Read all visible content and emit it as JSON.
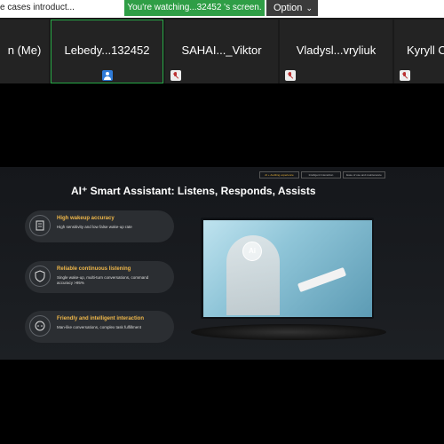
{
  "topbar": {
    "title_fragment": "e cases introduct...",
    "watching_text": "You're watching...32452 's screen.",
    "option_label": "Option"
  },
  "participants": [
    {
      "name": "n (Me)"
    },
    {
      "name": "Lebedy...132452"
    },
    {
      "name": "SAHAI..._Viktor"
    },
    {
      "name": "Vladysl...vryliuk"
    },
    {
      "name": "Kyryll O"
    }
  ],
  "slide": {
    "tabs": [
      "AI + Auditing experience",
      "Intelligent Interaction",
      "Ease of use and maintenance"
    ],
    "title": "AI⁺ Smart Assistant: Listens, Responds, Assists",
    "features": [
      {
        "title": "High wakeup accuracy",
        "desc": "High sensitivity and low false wake-up rate"
      },
      {
        "title": "Reliable continuous listening",
        "desc": "Single wake-up, multi-turn conversations, command accuracy >95%"
      },
      {
        "title": "Friendly and intelligent interaction",
        "desc": "Man-like conversations, complex task fulfillment"
      }
    ],
    "ai_badge": "Ai"
  }
}
